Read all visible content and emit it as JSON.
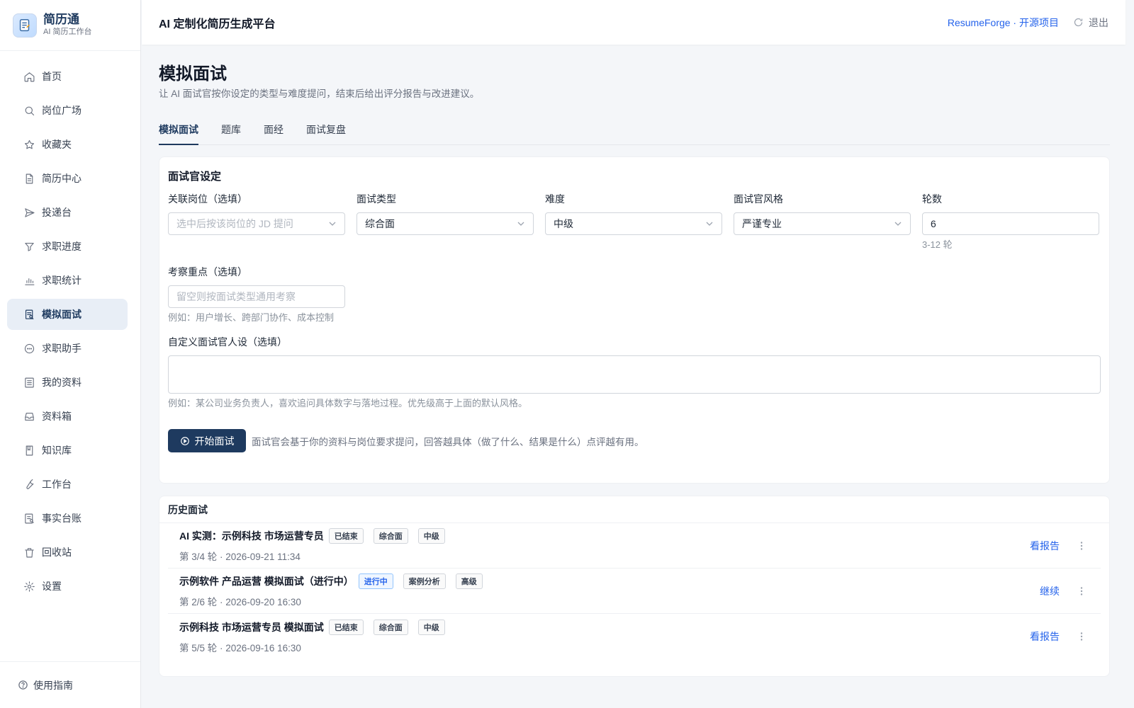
{
  "brand": {
    "name": "简历通",
    "sub": "AI 简历工作台"
  },
  "nav": [
    {
      "label": "首页",
      "icon": "home-icon"
    },
    {
      "label": "岗位广场",
      "icon": "search-icon"
    },
    {
      "label": "收藏夹",
      "icon": "star-icon"
    },
    {
      "label": "简历中心",
      "icon": "document-icon"
    },
    {
      "label": "投递台",
      "icon": "send-icon"
    },
    {
      "label": "求职进度",
      "icon": "filter-icon"
    },
    {
      "label": "求职统计",
      "icon": "bar-chart-icon"
    },
    {
      "label": "模拟面试",
      "icon": "interview-icon"
    },
    {
      "label": "求职助手",
      "icon": "chat-icon"
    },
    {
      "label": "我的资料",
      "icon": "profile-list-icon"
    },
    {
      "label": "资料箱",
      "icon": "inbox-icon"
    },
    {
      "label": "知识库",
      "icon": "book-icon"
    },
    {
      "label": "工作台",
      "icon": "wrench-icon"
    },
    {
      "label": "事实台账",
      "icon": "ledger-icon"
    },
    {
      "label": "回收站",
      "icon": "trash-icon"
    },
    {
      "label": "设置",
      "icon": "gear-icon"
    }
  ],
  "footer": {
    "label": "使用指南",
    "icon": "help-icon"
  },
  "topbar": {
    "title": "AI 定制化简历生成平台",
    "link": "ResumeForge · 开源项目",
    "logout": "退出"
  },
  "page": {
    "title": "模拟面试",
    "desc": "让 AI 面试官按你设定的类型与难度提问，结束后给出评分报告与改进建议。"
  },
  "tabs": [
    "模拟面试",
    "题库",
    "面经",
    "面试复盘"
  ],
  "config": {
    "title": "面试官设定",
    "position": {
      "label": "关联岗位（选填）",
      "placeholder": "选中后按该岗位的 JD 提问"
    },
    "type": {
      "label": "面试类型",
      "value": "综合面"
    },
    "difficulty": {
      "label": "难度",
      "value": "中级"
    },
    "style": {
      "label": "面试官风格",
      "value": "严谨专业"
    },
    "rounds": {
      "label": "轮数",
      "value": "6",
      "hint": "3-12 轮"
    },
    "focus": {
      "label": "考察重点（选填）",
      "placeholder": "留空则按面试类型通用考察",
      "hint": "例如：用户增长、跨部门协作、成本控制"
    },
    "persona": {
      "label": "自定义面试官人设（选填）",
      "hint": "例如：某公司业务负责人，喜欢追问具体数字与落地过程。优先级高于上面的默认风格。"
    },
    "start_button": "开始面试",
    "start_hint": "面试官会基于你的资料与岗位要求提问，回答越具体（做了什么、结果是什么）点评越有用。"
  },
  "history": {
    "title": "历史面试",
    "items": [
      {
        "title": "AI 实测：示例科技 市场运营专员",
        "status": "已结束",
        "type": "综合面",
        "level": "中级",
        "meta": "第 3/4 轮 · 2026-09-21 11:34",
        "action": "看报告"
      },
      {
        "title": "示例软件 产品运营 模拟面试（进行中）",
        "status": "进行中",
        "type": "案例分析",
        "level": "高级",
        "meta": "第 2/6 轮 · 2026-09-20 16:30",
        "action": "继续"
      },
      {
        "title": "示例科技 市场运营专员 模拟面试",
        "status": "已结束",
        "type": "综合面",
        "level": "中级",
        "meta": "第 5/5 轮 · 2026-09-16 16:30",
        "action": "看报告"
      }
    ]
  }
}
